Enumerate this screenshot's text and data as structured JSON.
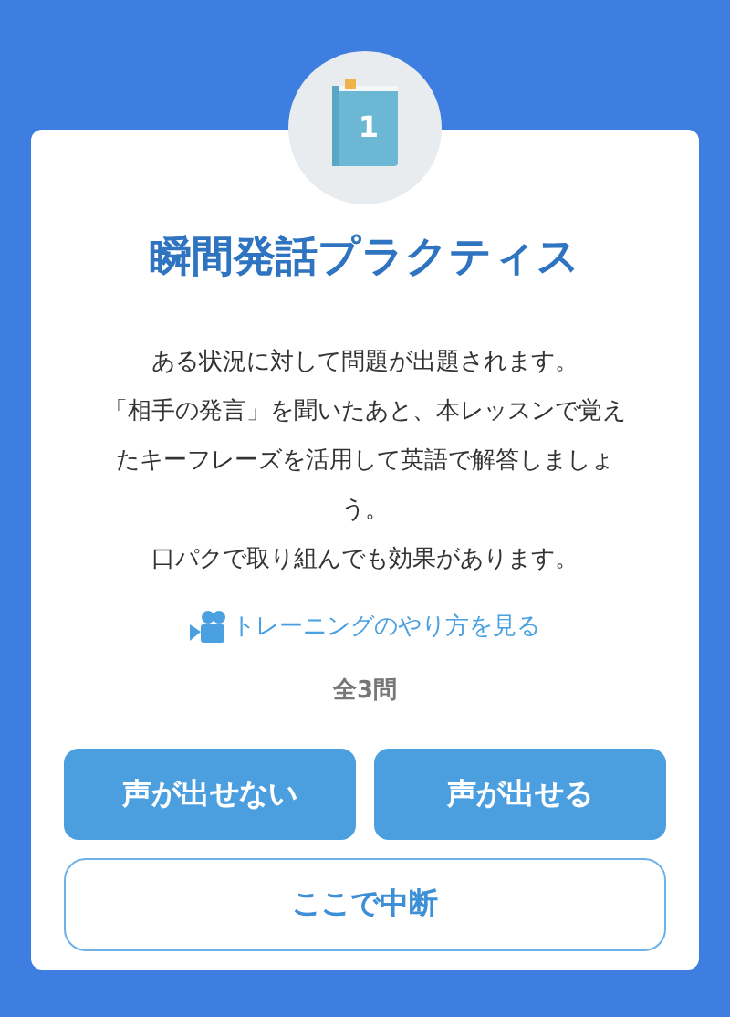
{
  "badge": {
    "number": "1"
  },
  "title": "瞬間発話プラクティス",
  "description": [
    "ある状況に対して問題が出題されます。",
    "「相手の発言」を聞いたあと、本レッスンで覚えたキーフレーズを活用して英語で解答しましょう。",
    "口パクで取り組んでも効果があります。"
  ],
  "video_link": "トレーニングのやり方を見る",
  "question_count": "全3問",
  "buttons": [
    {
      "label": "声が出せない",
      "kind": "filled"
    },
    {
      "label": "声が出せる",
      "kind": "filled"
    },
    {
      "label": "ここで中断",
      "kind": "outline"
    }
  ]
}
